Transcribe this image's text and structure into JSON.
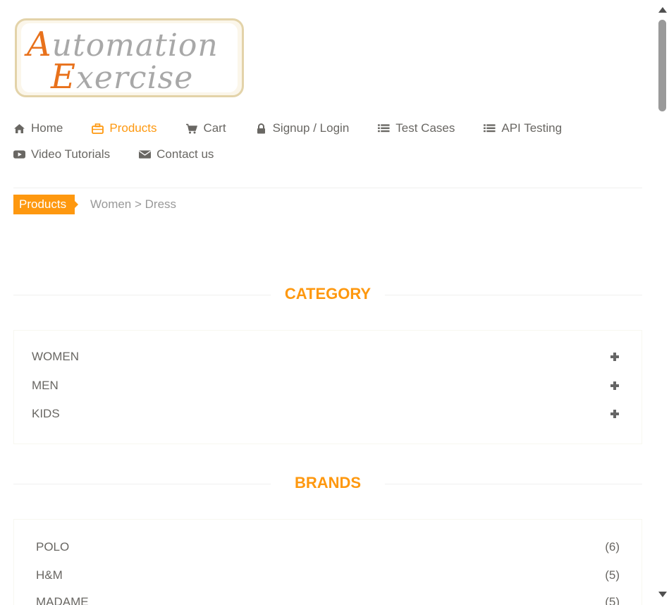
{
  "logo": {
    "line1_cap": "A",
    "line1_rest": "utomation",
    "line2_cap": "E",
    "line2_rest": "xercise"
  },
  "nav": {
    "items_row1": [
      {
        "label": "Home",
        "icon": "home-icon"
      },
      {
        "label": "Products",
        "icon": "briefcase-icon",
        "active": true
      },
      {
        "label": "Cart",
        "icon": "cart-icon"
      },
      {
        "label": "Signup / Login",
        "icon": "lock-icon"
      },
      {
        "label": "Test Cases",
        "icon": "list-icon"
      },
      {
        "label": "API Testing",
        "icon": "list-icon"
      }
    ],
    "items_row2": [
      {
        "label": "Video Tutorials",
        "icon": "youtube-play-icon"
      },
      {
        "label": "Contact us",
        "icon": "envelope-icon"
      }
    ]
  },
  "breadcrumb": {
    "active": "Products",
    "path": "Women > Dress"
  },
  "category": {
    "title": "CATEGORY",
    "items": [
      "WOMEN",
      "MEN",
      "KIDS"
    ]
  },
  "brands": {
    "title": "BRANDS",
    "items": [
      {
        "name": "POLO",
        "count": "(6)"
      },
      {
        "name": "H&M",
        "count": "(5)"
      },
      {
        "name": "MADAME",
        "count": "(5)"
      }
    ]
  },
  "colors": {
    "accent": "#FE980F",
    "text": "#696763",
    "muted": "#999999"
  }
}
